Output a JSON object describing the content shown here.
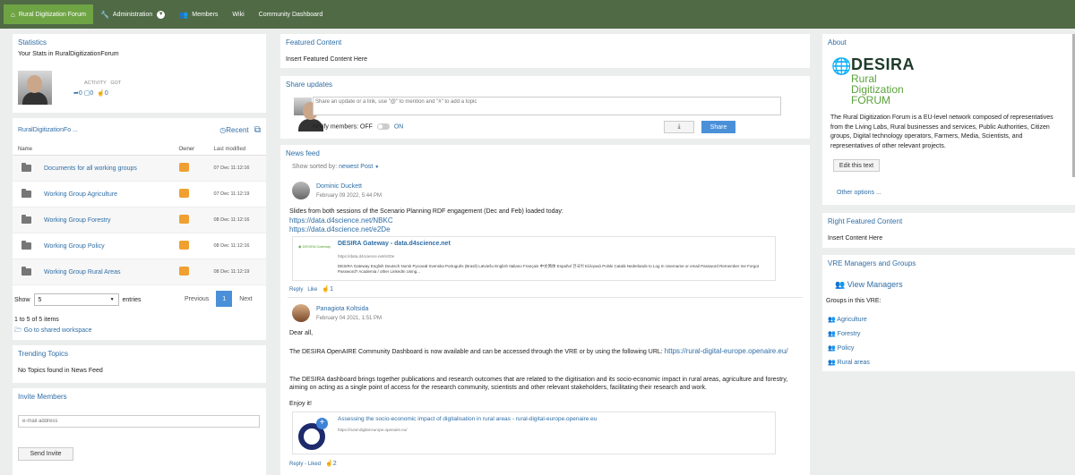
{
  "nav": {
    "items": [
      {
        "label": "Rural Digitization Forum",
        "icon": "home-icon"
      },
      {
        "label": "Administration",
        "icon": "wrench-icon"
      },
      {
        "label": "Members",
        "icon": "users-icon"
      },
      {
        "label": "Wiki"
      },
      {
        "label": "Community Dashboard"
      }
    ]
  },
  "stats": {
    "title": "Statistics",
    "subtitle": "Your Stats in RuralDigitizationForum",
    "activity_label": "ACTIVITY",
    "got_label": "GOT",
    "shares": "0",
    "comments": "0",
    "likes": "0"
  },
  "workspace": {
    "title": "RuralDigitizationFo ...",
    "recent_label": "Recent",
    "columns": [
      "Name",
      "Owner",
      "Last modified"
    ],
    "rows": [
      {
        "name": "Documents for all working groups",
        "owner": "",
        "modified": "07 Dec 11:12:16"
      },
      {
        "name": "Working Group Agriculture",
        "owner": "",
        "modified": "07 Dec 11:12:19"
      },
      {
        "name": "Working Group Forestry",
        "owner": "",
        "modified": "08 Dec 11:12:16"
      },
      {
        "name": "Working Group Policy",
        "owner": "",
        "modified": "08 Dec 11:12:16"
      },
      {
        "name": "Working Group Rural Areas",
        "owner": "",
        "modified": "08 Dec 11:12:19"
      }
    ],
    "show_label": "Show",
    "show_value": "5",
    "entries_label": "entries",
    "prev_label": "Previous",
    "page": "1",
    "next_label": "Next",
    "info": "1 to 5 of 5 items",
    "goto_label": "Go to shared workspace"
  },
  "trending": {
    "title": "Trending Topics",
    "empty": "No Topics found in News Feed"
  },
  "invite": {
    "title": "Invite Members",
    "placeholder": "e-mail address",
    "button": "Send Invite"
  },
  "featured": {
    "title": "Featured Content",
    "text": "Insert Featured Content Here"
  },
  "share": {
    "title": "Share updates",
    "placeholder": "Share an update or a link, use \"@\" to mention and \"#\" to add a topic",
    "notify_label": "Notify members: OFF",
    "on_label": "ON",
    "button": "Share"
  },
  "feed": {
    "title": "News feed",
    "sort_label": "Show sorted by:",
    "sort_value": "newest Post",
    "posts": [
      {
        "author": "Dominic Duckett",
        "date": "February 09 2022, 5:44 PM",
        "text": "Slides from both sessions of the Scenario Planning RDF engagement (Dec and Feb) loaded today:",
        "link1": "https://data.d4science.net/NBKC",
        "link2": "https://data.d4science.net/e2De",
        "attach_brand": "DESIRA Gateway",
        "attach_title": "DESIRA Gateway - data.d4science.net",
        "attach_url": "https://data.d4science.net/e2De",
        "attach_desc": "DESIRA Gateway English Deutsch Norsk Pусский Svenska Português (Brasil) Latviešu English Italiano Français 中文简体 Español 한국어 Ελληνικά Polski Català Nederlands to Log In Username or email Password Remember me Forgot Password? Academia / other LinkedIn Using...",
        "reply": "Reply",
        "like": "Like",
        "likes": "1"
      },
      {
        "author": "Panagiota Koltsida",
        "date": "February 04 2021, 1:51 PM",
        "greeting": "Dear all,",
        "text1": "The DESIRA OpenAIRE Community Dashboard is now available and can be accessed through the VRE or by using the following URL:",
        "link": "https://rural-digital-europe.openaire.eu/",
        "text2": "The DESIRA dashboard brings together publications and research outcomes that are related to the digitisation and its socio-economic impact in rural areas, agriculture and forestry, aiming on acting as a single point of access for the research community, scientists and other relevant stakeholders, facilitating their research and work.",
        "text3": "Enjoy it!",
        "attach_title": "Assessing the socio-economic impact of digitalisation in rural areas - rural-digital-europe.openaire.eu",
        "attach_url": "https://rural-digital-europe.openaire.eu/",
        "reply": "Reply",
        "like": "Liked",
        "likes": "2"
      }
    ]
  },
  "about": {
    "title": "About",
    "logo_word": "DESIRA",
    "logo_line1": "Rural",
    "logo_line2": "Digitization",
    "logo_line3": "FORUM",
    "text": "The Rural Digitization Forum is a EU-level network composed of representatives from the Living Labs, Rural businesses and services, Public Authorities, Citizen groups, Digital technology operators, Farmers, Media, Scientists, and representatives of other relevant projects.",
    "edit_button": "Edit this text",
    "other_options": "Other options ..."
  },
  "right_featured": {
    "title": "Right Featured Content",
    "text": "Insert Content Here"
  },
  "managers": {
    "title": "VRE Managers and Groups",
    "view_label": "View Managers",
    "groups_label": "Groups in this VRE:",
    "groups": [
      "Agriculture",
      "Forestry",
      "Policy",
      "Rural areas"
    ]
  },
  "colors": {
    "nav_bg": "#4f6a45",
    "nav_active": "#6fa445",
    "link": "#2f6ea5",
    "primary_button": "#4a90d9",
    "owner_badge": "#f0a030",
    "logo_green": "#5aa23a"
  }
}
